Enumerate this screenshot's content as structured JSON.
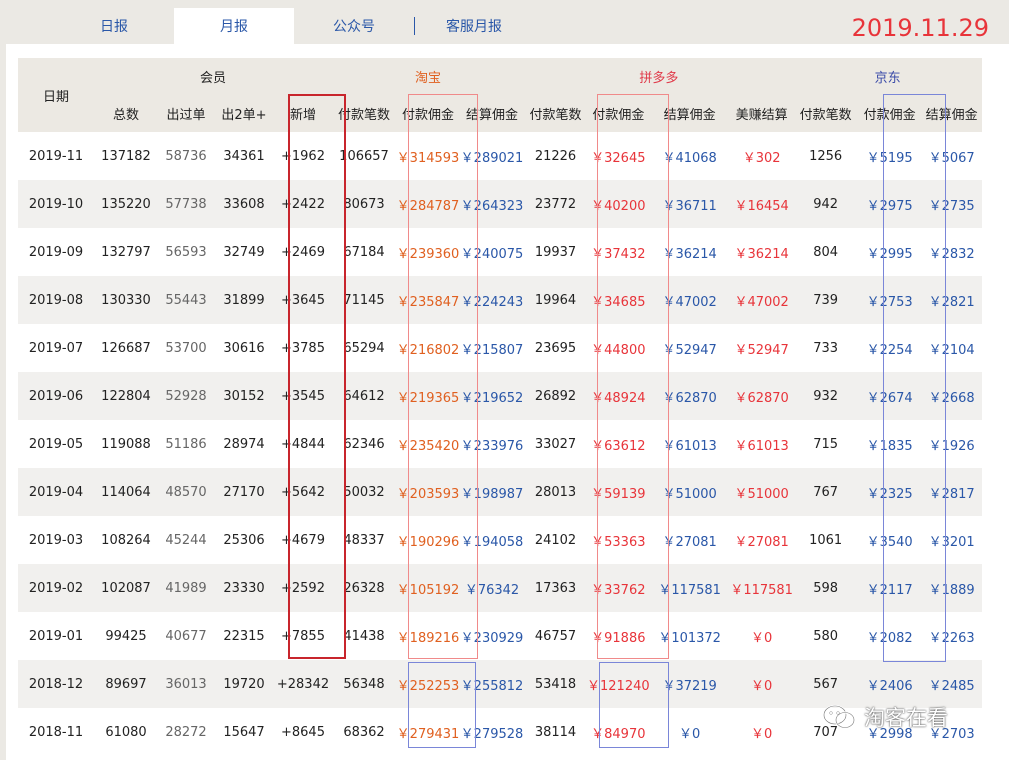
{
  "tabs": [
    {
      "label": "日报",
      "active": false
    },
    {
      "label": "月报",
      "active": true
    },
    {
      "label": "公众号",
      "active": false
    },
    {
      "label": "客服月报",
      "active": false
    }
  ],
  "report_date": "2019.11.29",
  "header": {
    "date": "日期",
    "groups": {
      "members": "会员",
      "taobao": "淘宝",
      "pdd": "拼多多",
      "jd": "京东"
    },
    "columns": [
      "总数",
      "出过单",
      "出2单+",
      "新增",
      "付款笔数",
      "付款佣金",
      "结算佣金",
      "付款笔数",
      "付款佣金",
      "结算佣金",
      "美赚结算",
      "付款笔数",
      "付款佣金",
      "结算佣金"
    ]
  },
  "rows": [
    [
      "2019-11",
      "137182",
      "58736",
      "34361",
      "+1962",
      "106657",
      "￥314593",
      "￥289021",
      "21226",
      "￥32645",
      "￥41068",
      "￥302",
      "1256",
      "￥5195",
      "￥5067"
    ],
    [
      "2019-10",
      "135220",
      "57738",
      "33608",
      "+2422",
      "80673",
      "￥284787",
      "￥264323",
      "23772",
      "￥40200",
      "￥36711",
      "￥16454",
      "942",
      "￥2975",
      "￥2735"
    ],
    [
      "2019-09",
      "132797",
      "56593",
      "32749",
      "+2469",
      "67184",
      "￥239360",
      "￥240075",
      "19937",
      "￥37432",
      "￥36214",
      "￥36214",
      "804",
      "￥2995",
      "￥2832"
    ],
    [
      "2019-08",
      "130330",
      "55443",
      "31899",
      "+3645",
      "71145",
      "￥235847",
      "￥224243",
      "19964",
      "￥34685",
      "￥47002",
      "￥47002",
      "739",
      "￥2753",
      "￥2821"
    ],
    [
      "2019-07",
      "126687",
      "53700",
      "30616",
      "+3785",
      "65294",
      "￥216802",
      "￥215807",
      "23695",
      "￥44800",
      "￥52947",
      "￥52947",
      "733",
      "￥2254",
      "￥2104"
    ],
    [
      "2019-06",
      "122804",
      "52928",
      "30152",
      "+3545",
      "64612",
      "￥219365",
      "￥219652",
      "26892",
      "￥48924",
      "￥62870",
      "￥62870",
      "932",
      "￥2674",
      "￥2668"
    ],
    [
      "2019-05",
      "119088",
      "51186",
      "28974",
      "+4844",
      "62346",
      "￥235420",
      "￥233976",
      "33027",
      "￥63612",
      "￥61013",
      "￥61013",
      "715",
      "￥1835",
      "￥1926"
    ],
    [
      "2019-04",
      "114064",
      "48570",
      "27170",
      "+5642",
      "50032",
      "￥203593",
      "￥198987",
      "28013",
      "￥59139",
      "￥51000",
      "￥51000",
      "767",
      "￥2325",
      "￥2817"
    ],
    [
      "2019-03",
      "108264",
      "45244",
      "25306",
      "+4679",
      "48337",
      "￥190296",
      "￥194058",
      "24102",
      "￥53363",
      "￥27081",
      "￥27081",
      "1061",
      "￥3540",
      "￥3201"
    ],
    [
      "2019-02",
      "102087",
      "41989",
      "23330",
      "+2592",
      "26328",
      "￥105192",
      "￥76342",
      "17363",
      "￥33762",
      "￥117581",
      "￥117581",
      "598",
      "￥2117",
      "￥1889"
    ],
    [
      "2019-01",
      "99425",
      "40677",
      "22315",
      "+7855",
      "41438",
      "￥189216",
      "￥230929",
      "46757",
      "￥91886",
      "￥101372",
      "￥0",
      "580",
      "￥2082",
      "￥2263"
    ],
    [
      "2018-12",
      "89697",
      "36013",
      "19720",
      "+28342",
      "56348",
      "￥252253",
      "￥255812",
      "53418",
      "￥121240",
      "￥37219",
      "￥0",
      "567",
      "￥2406",
      "￥2485"
    ],
    [
      "2018-11",
      "61080",
      "28272",
      "15647",
      "+8645",
      "68362",
      "￥279431",
      "￥279528",
      "38114",
      "￥84970",
      "￥0",
      "￥0",
      "707",
      "￥2998",
      "￥2703"
    ]
  ],
  "column_colors": [
    "#222222",
    "#222222",
    "#666666",
    "#222222",
    "#222222",
    "#222222",
    "#e06020",
    "#2a57a8",
    "#222222",
    "#e8343a",
    "#2a57a8",
    "#e8343a",
    "#222222",
    "#2a57a8",
    "#2a57a8"
  ],
  "highlight_colors": {
    "red": "#c8252c",
    "pink": "#f08a8a",
    "blue": "#7a86d8"
  },
  "watermark": "淘客在看"
}
